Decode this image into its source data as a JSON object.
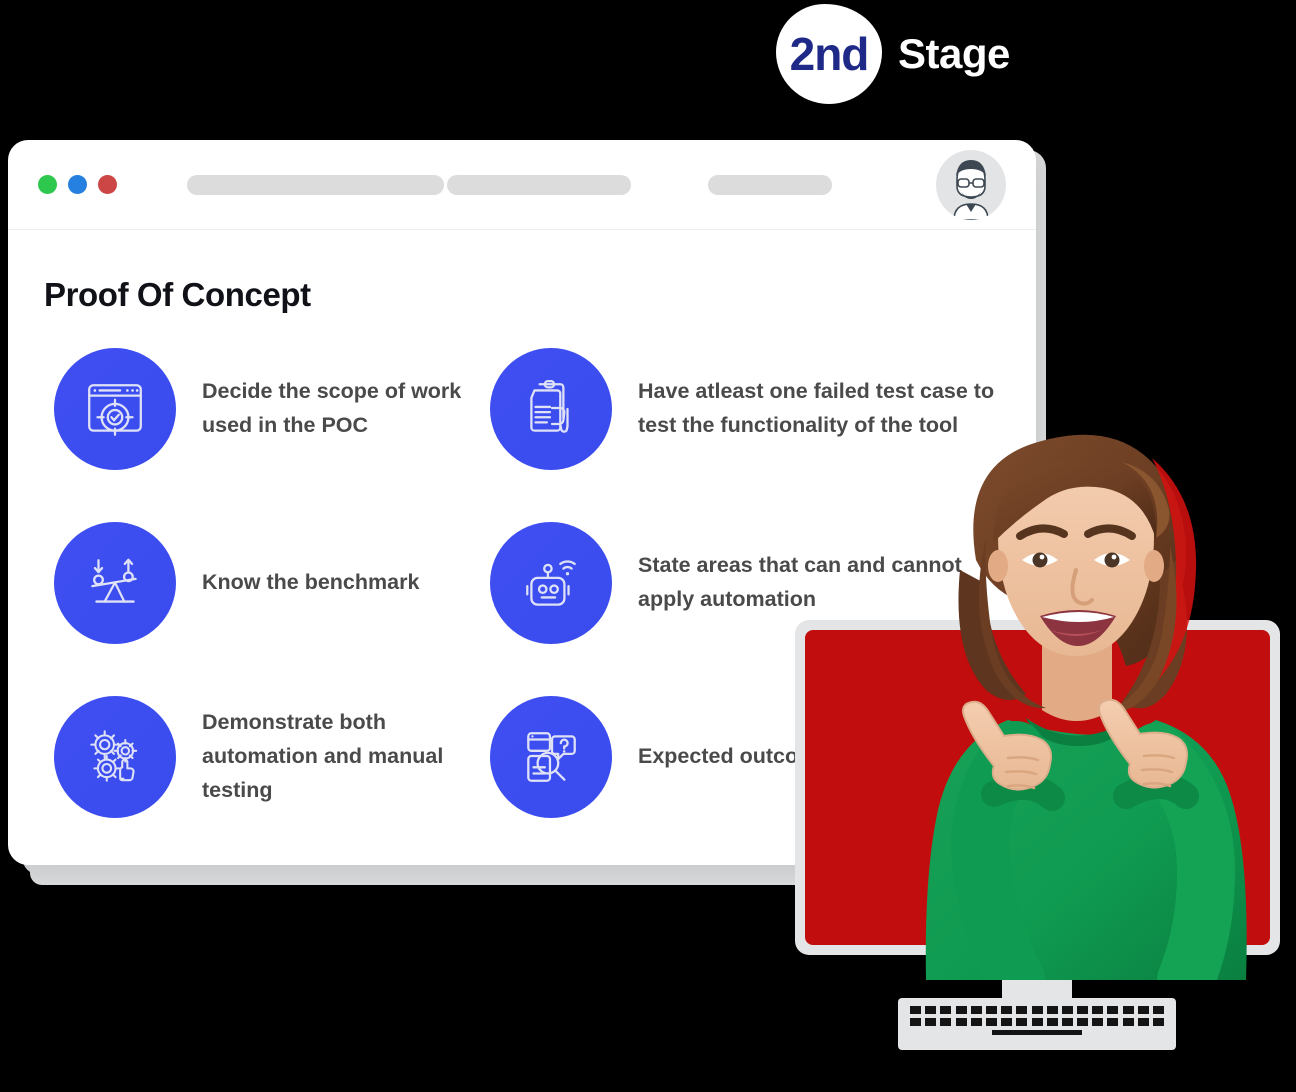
{
  "badge": {
    "number": "2nd",
    "word": "Stage",
    "number_color": "#1f2a88",
    "word_color": "#ffffff"
  },
  "browser": {
    "traffic_lights": [
      {
        "name": "green",
        "color": "#2dc84d"
      },
      {
        "name": "blue",
        "color": "#2580e0"
      },
      {
        "name": "red",
        "color": "#cc4646"
      }
    ],
    "address_pills": [
      "pill-left",
      "pill-right",
      "pill-tab"
    ],
    "avatar_label": "user-avatar"
  },
  "page": {
    "title": "Proof Of Concept",
    "accent_color": "#3f4ff2",
    "text_color": "#4a4a4a",
    "items": [
      {
        "icon": "browser-target-icon",
        "label": "Decide the scope of work used in the POC"
      },
      {
        "icon": "document-thumbs-down-icon",
        "label": "Have atleast one failed test case to test the functionality of the tool"
      },
      {
        "icon": "seesaw-balance-icon",
        "label": "Know the benchmark"
      },
      {
        "icon": "robot-wifi-icon",
        "label": "State areas that can and cannot apply automation"
      },
      {
        "icon": "gears-hand-icon",
        "label": "Demonstrate both automation and manual testing"
      },
      {
        "icon": "document-search-question-icon",
        "label": "Expected outcome of the POC"
      }
    ]
  },
  "monitor": {
    "screen_color": "#c10d0d",
    "bezel_color": "#e4e5e6",
    "photo_description": "woman-thumbs-up-photo"
  }
}
